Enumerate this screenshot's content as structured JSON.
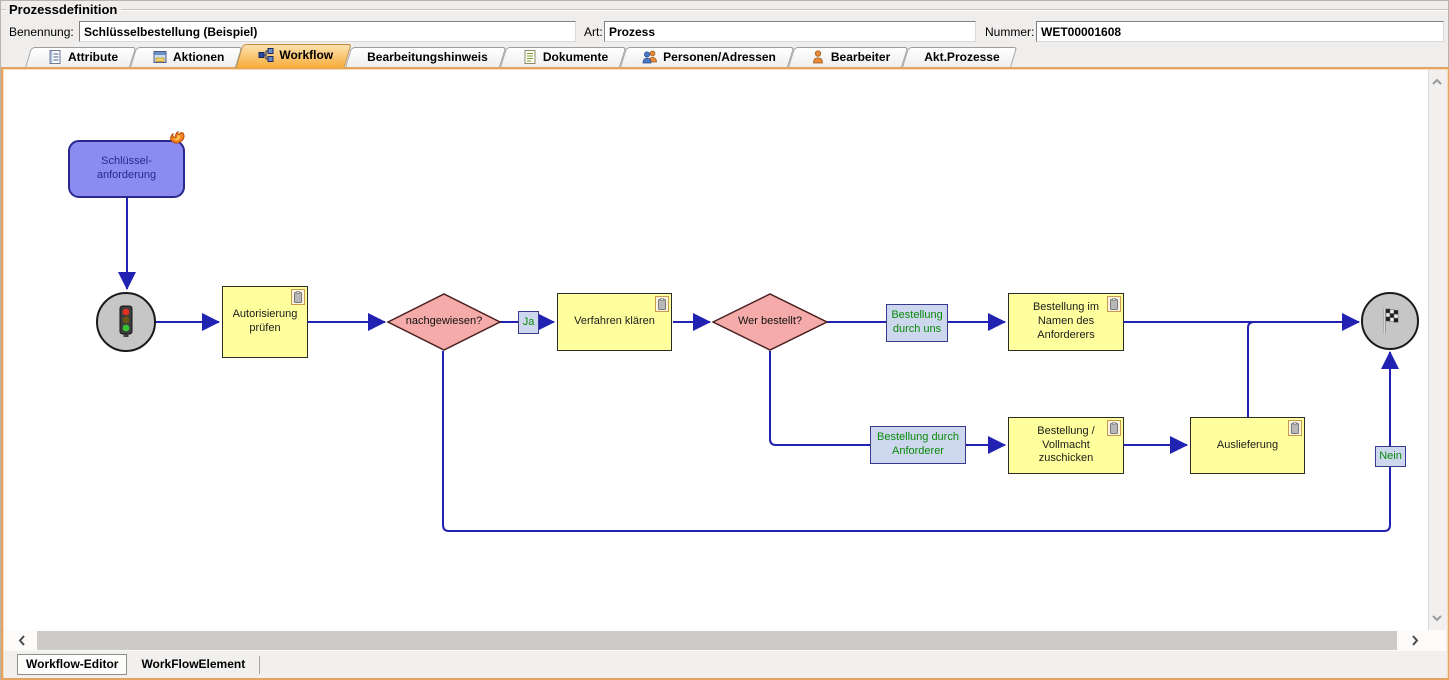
{
  "header": {
    "title": "Prozessdefinition",
    "fields": [
      {
        "label": "Benennung:",
        "value": "Schlüsselbestellung (Beispiel)"
      },
      {
        "label": "Art:",
        "value": "Prozess"
      },
      {
        "label": "Nummer:",
        "value": "WET00001608"
      }
    ]
  },
  "tabs": [
    {
      "label": "Attribute",
      "icon": "attribute-icon",
      "active": false
    },
    {
      "label": "Aktionen",
      "icon": "actions-icon",
      "active": false
    },
    {
      "label": "Workflow",
      "icon": "workflow-icon",
      "active": true
    },
    {
      "label": "Bearbeitungshinweis",
      "icon": null,
      "active": false
    },
    {
      "label": "Dokumente",
      "icon": "document-icon",
      "active": false
    },
    {
      "label": "Personen/Adressen",
      "icon": "persons-icon",
      "active": false
    },
    {
      "label": "Bearbeiter",
      "icon": "person-icon",
      "active": false
    },
    {
      "label": "Akt.Prozesse",
      "icon": null,
      "active": false
    }
  ],
  "diagram": {
    "nodes": {
      "event_start": "Schlüssel-anforderung",
      "task_autorisierung": "Autorisierung prüfen",
      "decision_nachgewiesen": "nachgewiesen?",
      "task_verfahren": "Verfahren klären",
      "decision_wer_bestellt": "Wer bestellt?",
      "task_bestellung_namen": "Bestellung im Namen des Anforderers",
      "task_bestellung_vollmacht": "Bestellung / Vollmacht zuschicken",
      "task_auslieferung": "Auslieferung"
    },
    "edge_labels": {
      "ja": "Ja",
      "nein": "Nein",
      "durch_uns": "Bestellung durch uns",
      "durch_anforderer": "Bestellung durch Anforderer"
    },
    "colors": {
      "task_fill": "#ffff9e",
      "decision_fill": "#f6abab",
      "decision_stroke": "#4a2020",
      "event_fill": "#8b8bf0",
      "edge": "#2222b2",
      "label_fill": "#cdd7ee",
      "label_text": "#0a8a0a",
      "node_circle_fill": "#c6c6c6",
      "panel_border": "#e3a462",
      "active_tab": "#f6ab38"
    }
  },
  "bottom_tabs": [
    {
      "label": "Workflow-Editor",
      "active": true
    },
    {
      "label": "WorkFlowElement",
      "active": false
    }
  ]
}
